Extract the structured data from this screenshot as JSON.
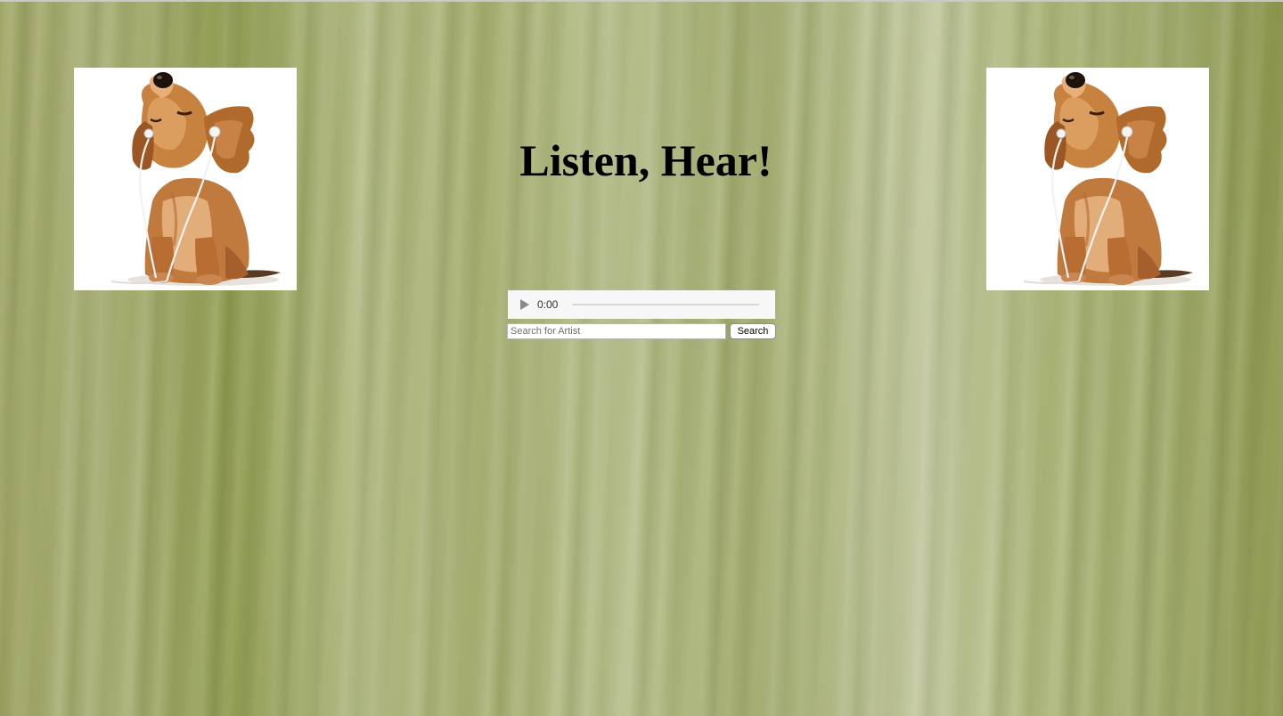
{
  "page": {
    "title": "Listen, Hear!"
  },
  "images": {
    "left": {
      "icon": "puppy-with-earphones"
    },
    "right": {
      "icon": "puppy-with-earphones"
    }
  },
  "audio": {
    "time": "0:00",
    "progress": 0
  },
  "search": {
    "placeholder": "Search for Artist",
    "value": "",
    "button_label": "Search"
  },
  "colors": {
    "background": "#a4ab72",
    "title": "#000000",
    "player_bg": "#f7f7f7"
  }
}
